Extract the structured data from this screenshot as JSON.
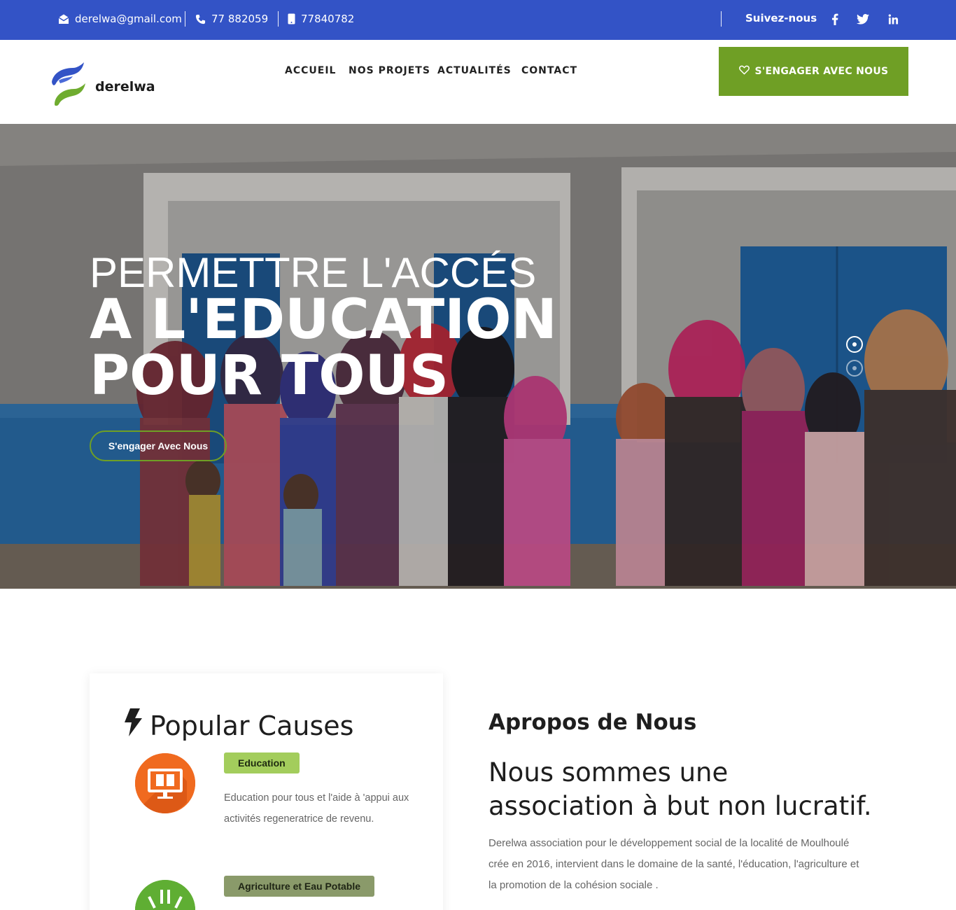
{
  "topbar": {
    "email": "derelwa@gmail.com",
    "phone": "77 882059",
    "mobile": "77840782",
    "follow_label": "Suivez-nous",
    "icons": [
      "envelope-icon",
      "phone-icon",
      "mobile-icon",
      "facebook-icon",
      "twitter-icon",
      "linkedin-icon"
    ]
  },
  "header": {
    "logo_text": "derelwa",
    "nav": [
      "ACCUEIL",
      "NOS PROJETS",
      "ACTUALITÉS",
      "CONTACT"
    ],
    "cta_label": "S'ENGAGER AVEC NOUS",
    "cta_icon": "heart-icon"
  },
  "hero": {
    "line1": "PERMETTRE L'ACCÉS",
    "line2": "A L'EDUCATION",
    "line3": "POUR TOUS",
    "button_label": "S'engager Avec Nous",
    "slide_count": 2,
    "active_slide": 1
  },
  "causes": {
    "title": "Popular Causes",
    "title_icon": "bolt-icon",
    "items": [
      {
        "tag": "Education",
        "description": "Education pour tous et l'aide à 'appui aux activités regeneratrice de revenu.",
        "icon": "education-monitor-icon"
      },
      {
        "tag": "Agriculture et Eau Potable",
        "icon": "agriculture-hands-icon"
      }
    ]
  },
  "about": {
    "title": "Apropos de Nous",
    "subtitle": "Nous sommes une association à but non lucratif.",
    "text": "Derelwa association pour le développement social de la localité de Moulhoulé crée en 2016, intervient dans le domaine de la santé, l'éducation, l'agriculture et la promotion de la cohésion sociale ."
  },
  "colors": {
    "topbar": "#3353c6",
    "accent_green": "#6f9f25",
    "tag_green": "#a3cd5c",
    "tag_olive": "#8a9a6a"
  }
}
